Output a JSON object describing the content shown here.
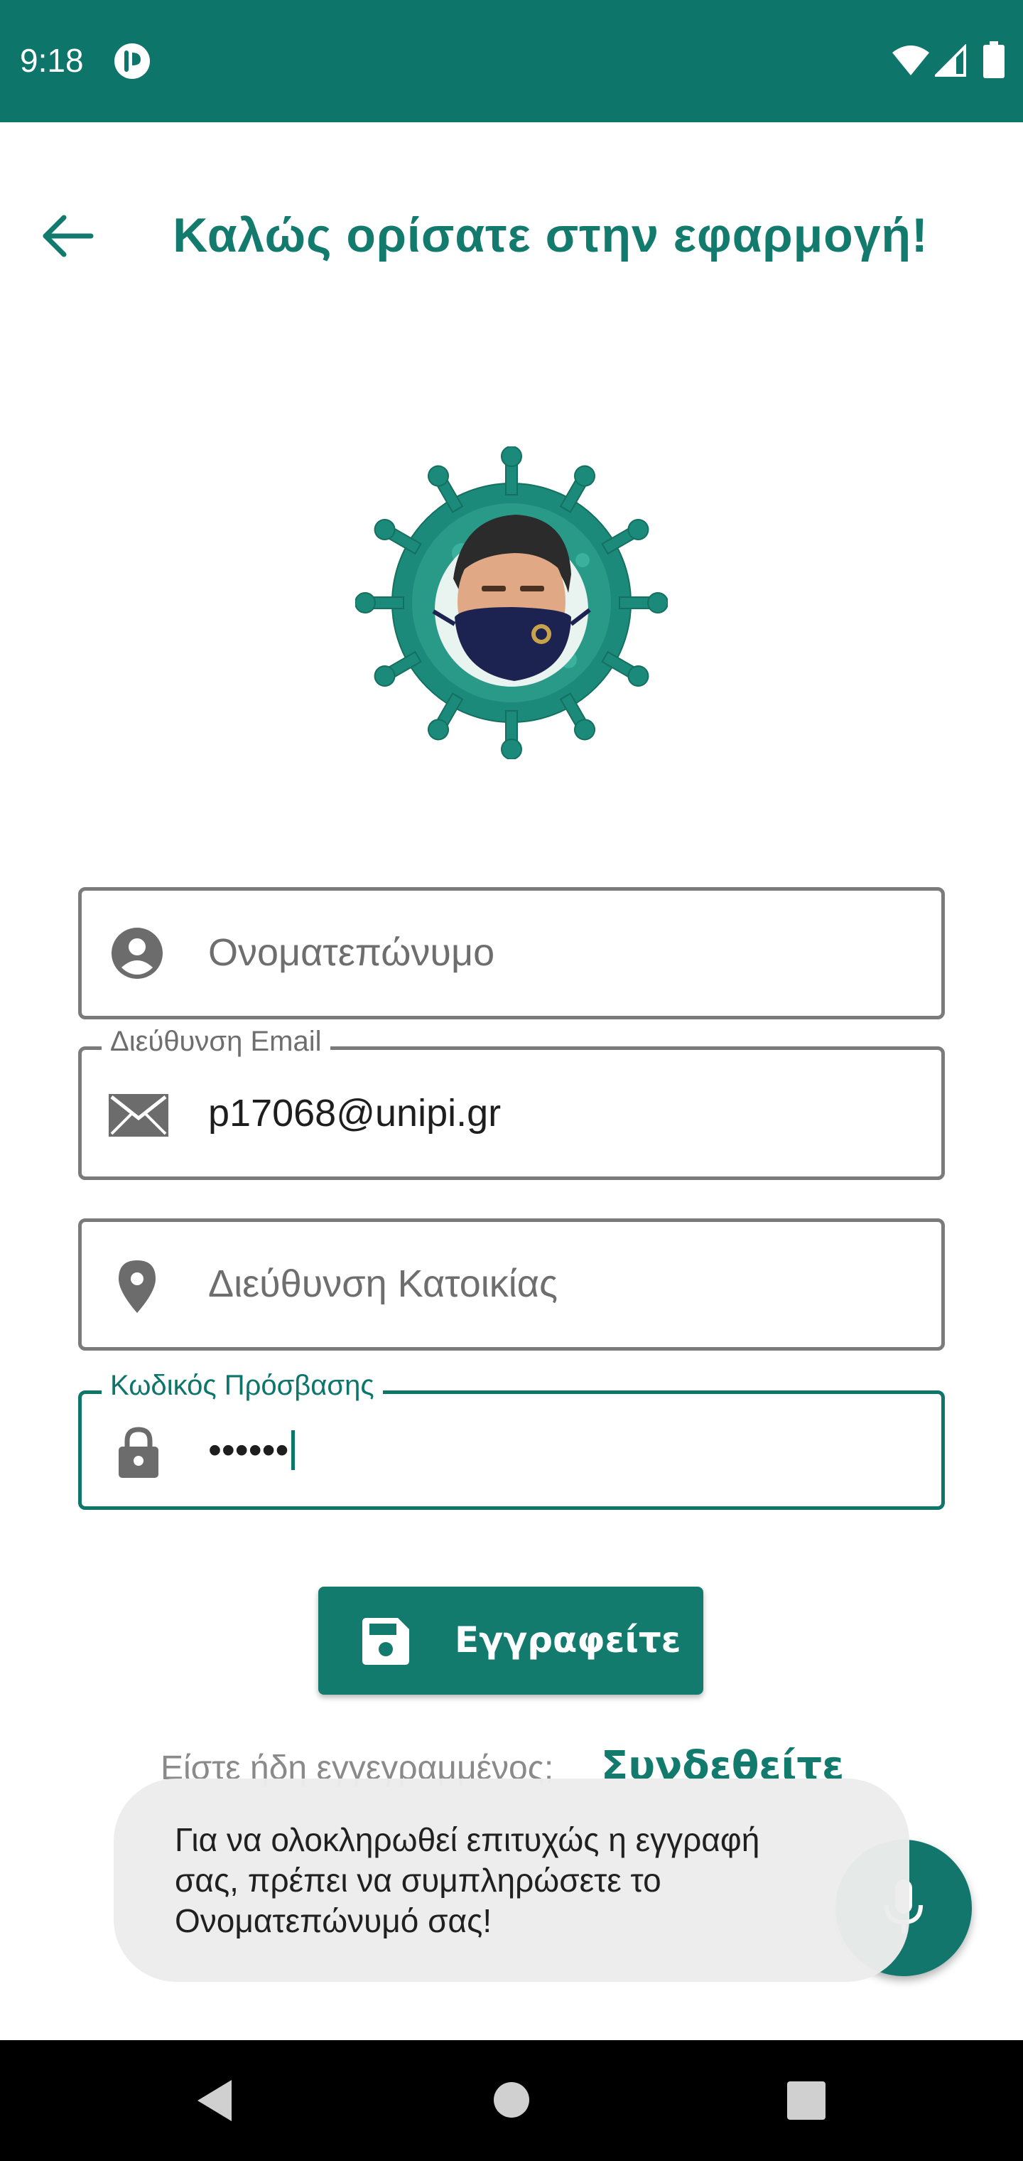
{
  "status_bar": {
    "time": "9:18",
    "icons": [
      "app-notification-icon",
      "wifi-icon",
      "signal-icon",
      "battery-icon"
    ]
  },
  "header": {
    "title": "Καλώς ορίσατε στην εφαρμογή!",
    "back_icon": "arrow-left-icon"
  },
  "form": {
    "full_name": {
      "placeholder": "Ονοματεπώνυμο",
      "value": "",
      "icon": "account-circle-icon"
    },
    "email": {
      "label": "Διεύθυνση Email",
      "value": "p17068@unipi.gr",
      "icon": "mail-icon"
    },
    "address": {
      "placeholder": "Διεύθυνση Κατοικίας",
      "value": "",
      "icon": "location-pin-icon"
    },
    "password": {
      "label": "Κωδικός Πρόσβασης",
      "value": "••••••",
      "icon": "lock-icon"
    },
    "register_label": "Εγγραφείτε",
    "register_icon": "save-icon",
    "login_prompt": "Είστε ήδη εγγεγραμμένος;",
    "login_link": "Συνδεθείτε"
  },
  "toast": {
    "line1": "Για να ολοκληρωθεί επιτυχώς η εγγραφή",
    "line2": "σας, πρέπει να συμπληρώσετε το",
    "line3": "Ονοματεπώνυμό σας!"
  },
  "fab": {
    "icon": "microphone-icon"
  },
  "colors": {
    "primary": "#0e756b",
    "accent_text": "#137a6e",
    "field_border": "#7b7b7b",
    "nav_bar": "#000000"
  }
}
